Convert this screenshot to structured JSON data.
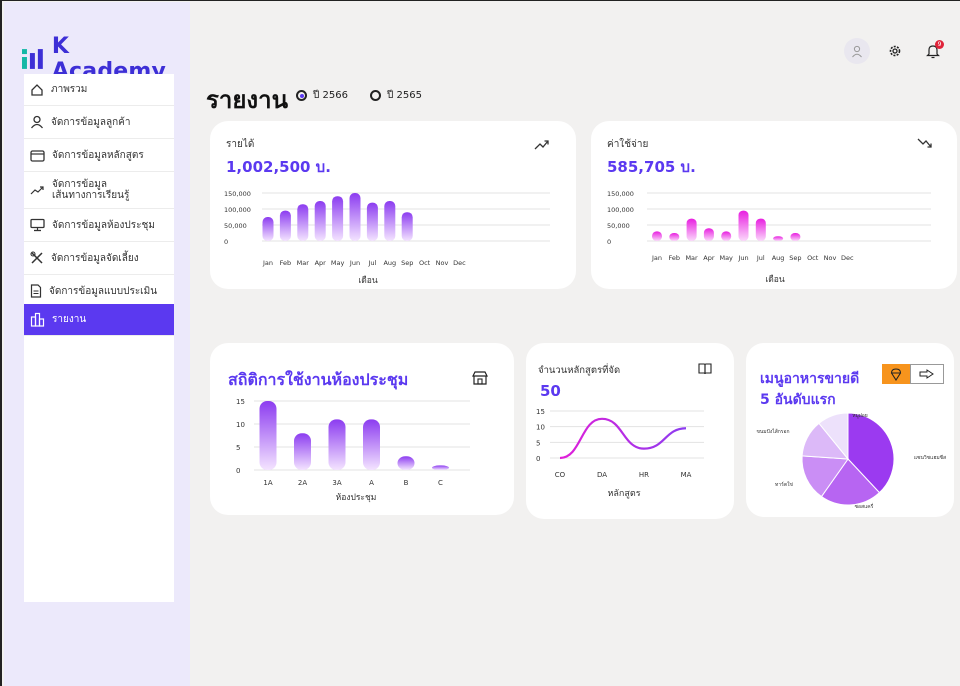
{
  "app": {
    "title": "K Academy"
  },
  "sidebar": {
    "items": [
      {
        "label": "ภาพรวม",
        "icon": "home-icon"
      },
      {
        "label": "จัดการข้อมูลลูกค้า",
        "icon": "user-icon"
      },
      {
        "label": "จัดการข้อมูลหลักสูตร",
        "icon": "folder-icon"
      },
      {
        "label": "จัดการข้อมูล",
        "label2": "เส้นทางการเรียนรู้",
        "icon": "trend-icon"
      },
      {
        "label": "จัดการข้อมูลห้องประชุม",
        "icon": "monitor-icon"
      },
      {
        "label": "จัดการข้อมูลจัดเลี้ยง",
        "icon": "utensils-icon"
      },
      {
        "label": "จัดการข้อมูลแบบประเมิน",
        "icon": "document-icon"
      },
      {
        "label": "รายงาน",
        "icon": "building-icon"
      }
    ],
    "active_index": 7
  },
  "header": {
    "notification_count": "9"
  },
  "page": {
    "title": "รายงาน",
    "year_options": [
      "ปี 2566",
      "ปี 2565"
    ],
    "selected_year": "ปี 2566"
  },
  "cards": {
    "income": {
      "title": "รายได้",
      "value": "1,002,500 บ."
    },
    "expense": {
      "title": "ค่าใช้จ่าย",
      "value": "585,705 บ."
    },
    "rooms": {
      "title": "สถิติการใช้งานห้องประชุม"
    },
    "courses": {
      "title": "จำนวนหลักสูตรที่จัด",
      "value": "50"
    },
    "menu": {
      "title1": "เมนูอาหารขายดี",
      "title2": "5 อันดับแรก"
    }
  },
  "chart_data": [
    {
      "type": "bar",
      "categories": [
        "Jan",
        "Feb",
        "Mar",
        "Apr",
        "May",
        "Jun",
        "Jul",
        "Aug",
        "Sep",
        "Oct",
        "Nov",
        "Dec"
      ],
      "values": [
        75000,
        95000,
        115000,
        125000,
        140000,
        150000,
        120000,
        125000,
        90000,
        null,
        null,
        null
      ],
      "yticks": [
        "150,000",
        "100,000",
        "50,000",
        "0"
      ],
      "ylim": [
        0,
        150000
      ],
      "xlabel": "เดือน"
    },
    {
      "type": "bar",
      "categories": [
        "Jan",
        "Feb",
        "Mar",
        "Apr",
        "May",
        "Jun",
        "Jul",
        "Aug",
        "Sep",
        "Oct",
        "Nov",
        "Dec"
      ],
      "values": [
        30000,
        25000,
        70000,
        40000,
        30000,
        95000,
        70000,
        15000,
        25000,
        null,
        null,
        null
      ],
      "yticks": [
        "150,000",
        "100,000",
        "50,000",
        "0"
      ],
      "ylim": [
        0,
        150000
      ],
      "xlabel": "เดือน"
    },
    {
      "type": "bar",
      "categories": [
        "1A",
        "2A",
        "3A",
        "A",
        "B",
        "C"
      ],
      "values": [
        15,
        8,
        11,
        11,
        3,
        1
      ],
      "yticks": [
        "15",
        "10",
        "5",
        "0"
      ],
      "ylim": [
        0,
        15
      ],
      "xlabel": "ห้องประชุม"
    },
    {
      "type": "line",
      "categories": [
        "CO",
        "DA",
        "HR",
        "MA"
      ],
      "values": [
        0,
        12.5,
        3,
        9.5
      ],
      "yticks": [
        "15",
        "10",
        "5",
        "0"
      ],
      "ylim": [
        0,
        15
      ],
      "xlabel": "หลักสูตร"
    },
    {
      "type": "pie",
      "labels": [
        "หมูฝอย",
        "แซนวิชแฮมชีส",
        "ซอสแครี่",
        "ทาร์ตใข่",
        "ขนมปังไส้กรอก"
      ],
      "values": [
        35,
        20,
        15,
        12,
        10
      ],
      "colors": [
        "#9b3af0",
        "#b765f2",
        "#ca8ef5",
        "#dcb9f8",
        "#ede1fb"
      ]
    }
  ]
}
